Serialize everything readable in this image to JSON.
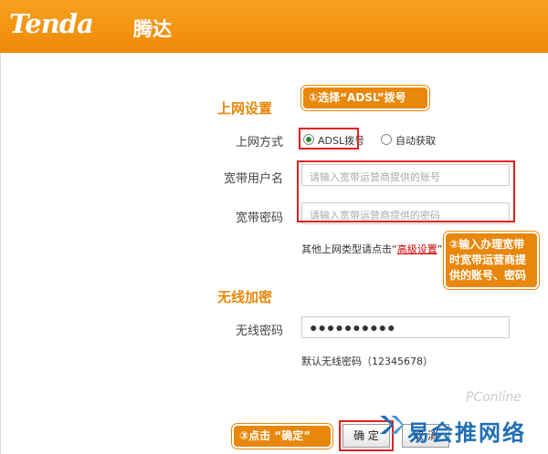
{
  "header": {
    "logo": "Tenda",
    "logo_cn": "腾达"
  },
  "internet": {
    "title": "上网设置",
    "mode_label": "上网方式",
    "options": [
      "ADSL拨号",
      "自动获取"
    ],
    "selected": "ADSL拨号",
    "username_label": "宽带用户名",
    "username_placeholder": "请输入宽带运营商提供的账号",
    "password_label": "宽带密码",
    "password_placeholder": "请输入宽带运营商提供的密码",
    "other_prefix": "其他上网类型请点击",
    "other_quote": "“",
    "advanced_link": "高级设置",
    "other_suffix": "”"
  },
  "wireless": {
    "title": "无线加密",
    "password_label": "无线密码",
    "password_value": "●●●●●●●●●●",
    "default_hint": "默认无线密码（12345678）"
  },
  "buttons": {
    "confirm": "确 定",
    "cancel": "取 消"
  },
  "callouts": {
    "step1": "①选择“ADSL”拨号",
    "step2_lines": [
      "②输入办理宽带",
      "时宽带运营商提",
      "供的账号、密码"
    ],
    "step3": "③点击 “确定”"
  },
  "watermark": {
    "brand": "易会推网络",
    "pc": "PConline"
  }
}
